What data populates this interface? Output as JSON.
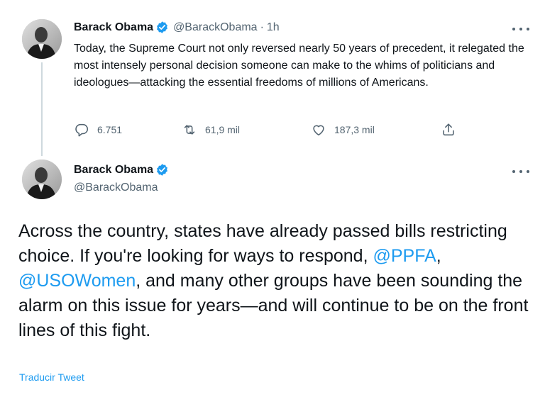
{
  "tweet1": {
    "author_name": "Barack Obama",
    "handle": "@BarackObama",
    "separator": "·",
    "time": "1h",
    "text": "Today, the Supreme Court not only reversed nearly 50 years of precedent, it relegated the most intensely personal decision someone can make to the whims of politicians and ideologues—attacking the essential freedoms of millions of Americans.",
    "replies": "6.751",
    "retweets": "61,9 mil",
    "likes": "187,3 mil"
  },
  "tweet2": {
    "author_name": "Barack Obama",
    "handle": "@BarackObama",
    "text_part1": "Across the country, states have already passed bills restricting choice. If you're looking for ways to respond, ",
    "mention1": "@PPFA",
    "text_part2": ", ",
    "mention2": "@USOWomen",
    "text_part3": ", and many other groups have been sounding the alarm on this issue for years—and will continue to be on the front lines of this fight.",
    "translate_label": "Traducir Tweet"
  },
  "colors": {
    "accent": "#1d9bf0",
    "secondary_text": "#536471",
    "primary_text": "#0f1419",
    "thread_line": "#cfd9de"
  },
  "icons": [
    "verified-badge-icon",
    "more-options-icon",
    "reply-icon",
    "retweet-icon",
    "like-icon",
    "share-icon"
  ]
}
